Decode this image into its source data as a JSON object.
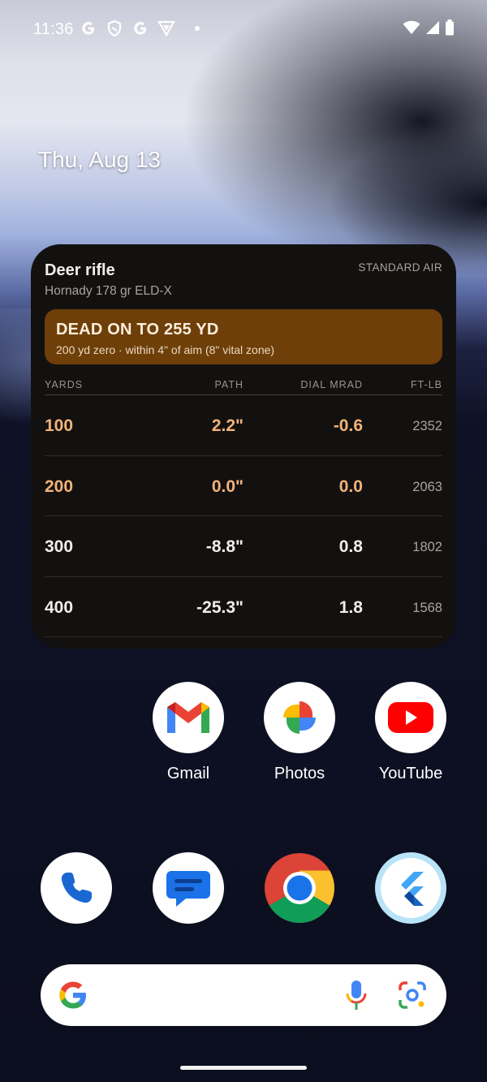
{
  "status_bar": {
    "time": "11:36",
    "left_icons": [
      "google-g-icon",
      "shield-icon",
      "google-g-icon",
      "vpn-icon",
      "notification-dot"
    ],
    "right_icons": [
      "wifi-icon",
      "cell-signal-icon",
      "battery-icon"
    ]
  },
  "date": "Thu, Aug 13",
  "widget": {
    "title": "Deer rifle",
    "subtitle": "Hornady 178 gr ELD-X",
    "air": "STANDARD AIR",
    "banner": {
      "title": "DEAD ON TO 255 YD",
      "subtitle": "200 yd zero · within 4\" of aim (8\" vital zone)",
      "color": "#6e3f08"
    },
    "table": {
      "headers": {
        "yards": "YARDS",
        "path": "PATH",
        "dial": "DIAL MRAD",
        "energy": "FT-LB"
      },
      "rows": [
        {
          "yards": "100",
          "path": "2.2\"",
          "dial": "-0.6",
          "energy": "2352"
        },
        {
          "yards": "200",
          "path": "0.0\"",
          "dial": "0.0",
          "energy": "2063"
        },
        {
          "yards": "300",
          "path": "-8.8\"",
          "dial": "0.8",
          "energy": "1802"
        },
        {
          "yards": "400",
          "path": "-25.3\"",
          "dial": "1.8",
          "energy": "1568"
        }
      ],
      "highlight_color": "#f3b37a"
    }
  },
  "apps_row1": [
    {
      "label": "Gmail",
      "icon": "gmail-icon"
    },
    {
      "label": "Photos",
      "icon": "photos-icon"
    },
    {
      "label": "YouTube",
      "icon": "youtube-icon"
    }
  ],
  "dock": [
    {
      "icon": "phone-icon"
    },
    {
      "icon": "messages-icon"
    },
    {
      "icon": "chrome-icon"
    },
    {
      "icon": "flutter-icon"
    }
  ],
  "search": {
    "icons": [
      "google-logo-icon",
      "mic-icon",
      "lens-icon"
    ]
  }
}
